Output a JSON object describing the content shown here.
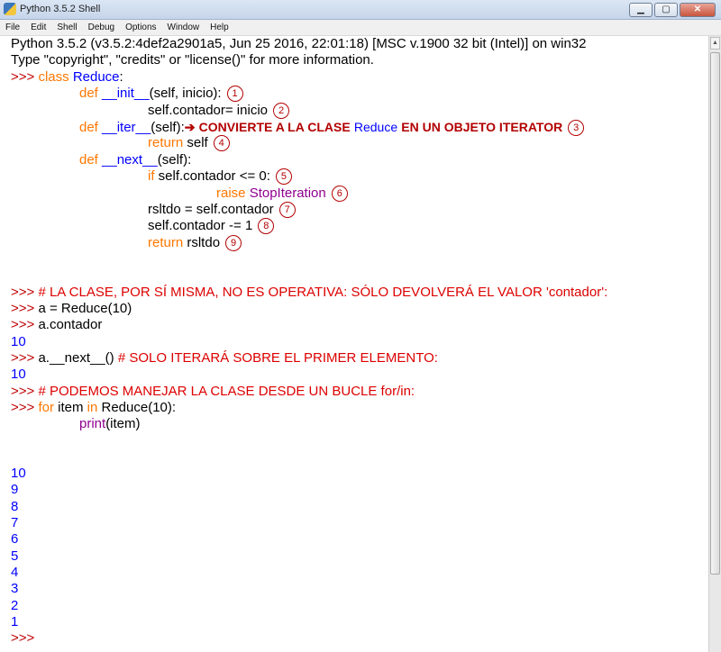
{
  "window": {
    "title": "Python 3.5.2 Shell",
    "minimize": "▁",
    "maximize": "▢",
    "close": "✕"
  },
  "menu": [
    "File",
    "Edit",
    "Shell",
    "Debug",
    "Options",
    "Window",
    "Help"
  ],
  "shell": {
    "banner1": "Python 3.5.2 (v3.5.2:4def2a2901a5, Jun 25 2016, 22:01:18) [MSC v.1900 32 bit (Intel)] on win32",
    "banner2": "Type \"copyright\", \"credits\" or \"license()\" for more information.",
    "prompt": ">>> ",
    "code": {
      "class_kw": "class",
      "class_name": "Reduce",
      "colon": ":",
      "def_kw": "def",
      "init_name": "__init__",
      "init_args": "(self, inicio):",
      "assign_contador": "self.contador= inicio",
      "iter_name": "__iter__",
      "iter_args": "(self):",
      "arrow": "➔",
      "ann_part1": "CONVIERTE A LA CLASE",
      "ann_class": "Reduce",
      "ann_part2": "EN UN OBJETO ITERATOR",
      "return_kw": "return",
      "return_self": " self",
      "next_name": "__next__",
      "next_args": "(self):",
      "if_kw": "if",
      "if_cond": " self.contador <= 0:",
      "raise_kw": "raise",
      "stop_iter": "StopIteration",
      "assign_rsltdo": "rsltdo = self.contador",
      "decrement": "self.contador -= 1",
      "return_rsltdo": " rsltdo"
    },
    "markers": [
      "1",
      "2",
      "3",
      "4",
      "5",
      "6",
      "7",
      "8",
      "9"
    ],
    "comment1": "# LA CLASE, POR SÍ MISMA, NO ES OPERATIVA: SÓLO DEVOLVERÁ EL VALOR 'contador':",
    "stmt_a_assign": "a = Reduce(10)",
    "stmt_a_contador": "a.contador",
    "out_10a": "10",
    "stmt_next": "a.__next__()",
    "comment2": "# SOLO ITERARÁ SOBRE EL PRIMER ELEMENTO:",
    "out_10b": "10",
    "comment3": "# PODEMOS MANEJAR LA CLASE DESDE UN BUCLE for/in:",
    "for_kw": "for",
    "for_item": " item ",
    "in_kw": "in",
    "for_iter": " Reduce(10):",
    "print_fn": "print",
    "print_args": "(item)",
    "loop_output": [
      "10",
      "9",
      "8",
      "7",
      "6",
      "5",
      "4",
      "3",
      "2",
      "1"
    ],
    "final_prompt": ">>> "
  }
}
